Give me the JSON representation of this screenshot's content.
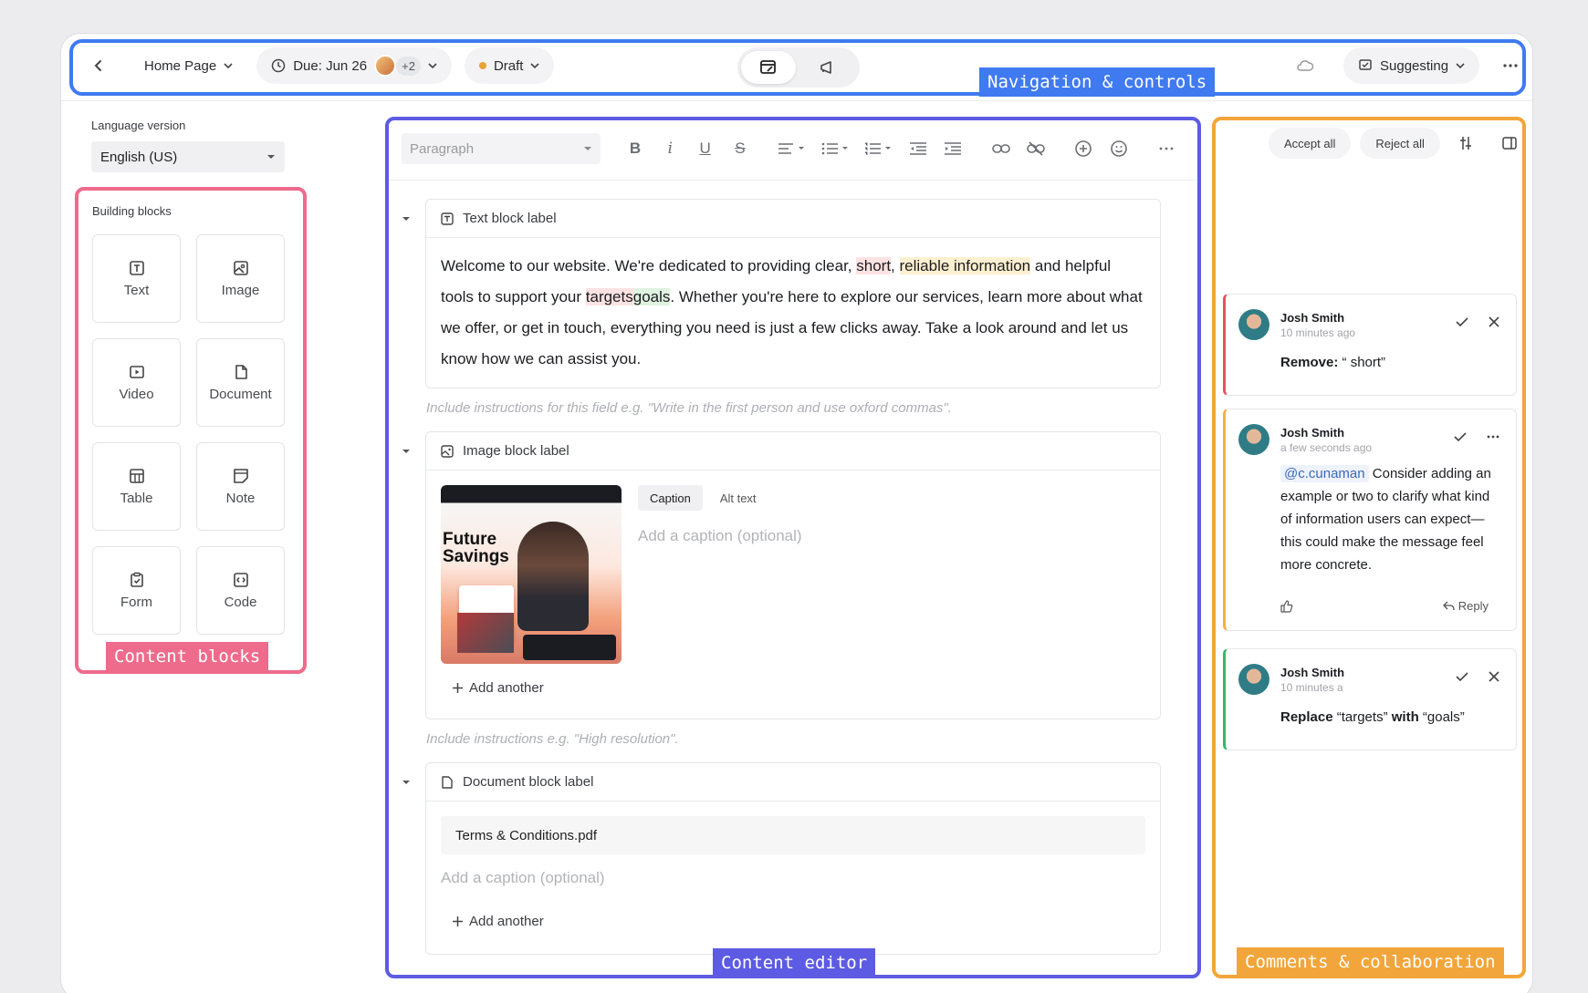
{
  "topbar": {
    "page_label": "Home Page",
    "due_label": "Due: Jun 26",
    "extra_assignees": "+2",
    "status_label": "Draft",
    "mode_label": "Suggesting"
  },
  "sidebar": {
    "language_label": "Language version",
    "language_value": "English (US)",
    "blocks_title": "Building blocks",
    "blocks": [
      {
        "label": "Text",
        "icon": "text-block-icon"
      },
      {
        "label": "Image",
        "icon": "image-block-icon"
      },
      {
        "label": "Video",
        "icon": "video-block-icon"
      },
      {
        "label": "Document",
        "icon": "document-block-icon"
      },
      {
        "label": "Table",
        "icon": "table-block-icon"
      },
      {
        "label": "Note",
        "icon": "note-block-icon"
      },
      {
        "label": "Form",
        "icon": "form-block-icon"
      },
      {
        "label": "Code",
        "icon": "code-block-icon"
      }
    ]
  },
  "editor": {
    "paragraph_placeholder": "Paragraph",
    "text_block": {
      "label": "Text block label",
      "seg1": "Welcome to our website. We're dedicated to providing clear, ",
      "short": "short",
      "seg2": ", ",
      "reliable": "reliable information",
      "seg3": " and helpful tools to support your ",
      "targets": "targets",
      "goals": "goals",
      "seg4": ". Whether you're here to explore our services, learn more about what we offer, or get in touch, everything you need is just a few clicks away. Take a look around and let us know how we can assist you.",
      "hint": "Include instructions for this field e.g. \"Write in the first person and use oxford commas\"."
    },
    "image_block": {
      "label": "Image block label",
      "thumb_title": "Future Savings",
      "tab_caption": "Caption",
      "tab_alt": "Alt text",
      "caption_placeholder": "Add a caption (optional)",
      "add_another": "Add another",
      "hint": "Include instructions e.g. \"High resolution\"."
    },
    "document_block": {
      "label": "Document block label",
      "file_name": "Terms & Conditions.pdf",
      "caption_placeholder": "Add a caption (optional)",
      "add_another": "Add another"
    }
  },
  "comments": {
    "accept_all": "Accept all",
    "reject_all": "Reject all",
    "items": [
      {
        "author": "Josh Smith",
        "time": "10 minutes ago",
        "action": "Remove:",
        "text": " “ short”"
      },
      {
        "author": "Josh Smith",
        "time": "a few seconds ago",
        "mention": "@c.cunaman",
        "text": " Consider adding an example or two to clarify what kind of information users can expect—this could make the message feel more concrete.",
        "reply": "Reply"
      },
      {
        "author": "Josh Smith",
        "time": "10 minutes a",
        "action": "Replace",
        "from": " “targets” ",
        "with": "with",
        "to": " “goals”"
      }
    ]
  },
  "annotations": {
    "nav": "Navigation & controls",
    "blocks": "Content blocks",
    "editor": "Content editor",
    "comments": "Comments & collaboration"
  },
  "colors": {
    "nav_highlight": "#3f7af0",
    "blocks_highlight": "#ee6b8c",
    "editor_highlight": "#5d5be3",
    "comments_highlight": "#f2a53a"
  }
}
